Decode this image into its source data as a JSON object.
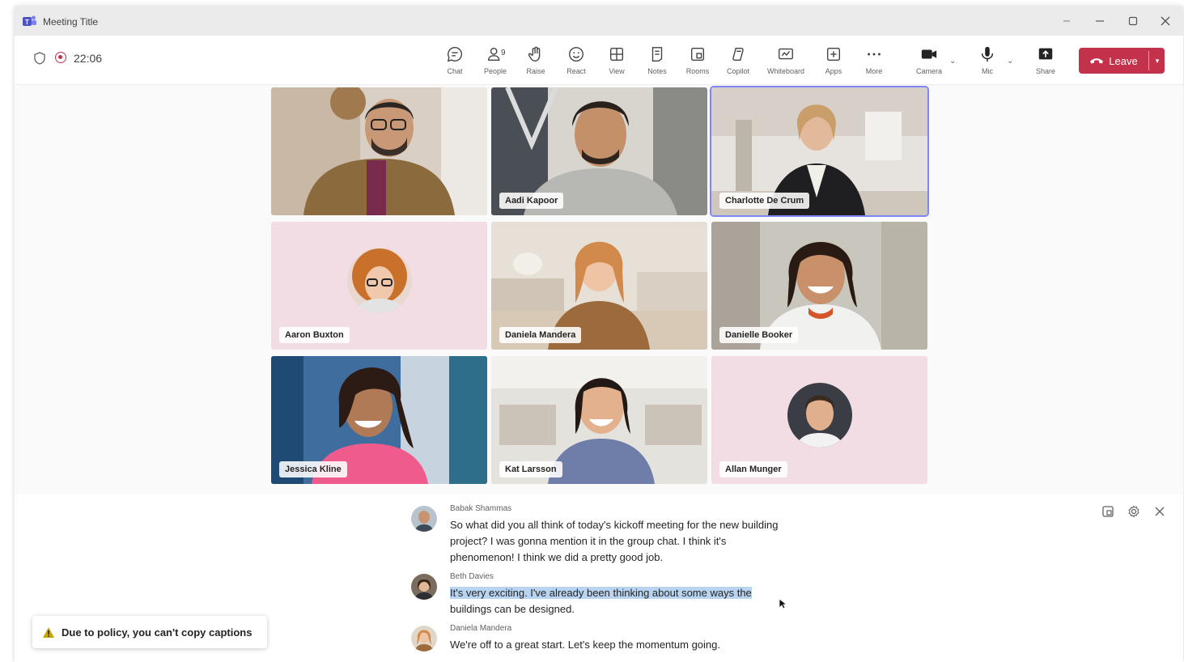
{
  "window": {
    "title": "Meeting Title"
  },
  "header": {
    "timer": "22:06",
    "people_count": "9"
  },
  "toolbar": {
    "items": [
      {
        "label": "Chat",
        "icon": "chat-icon"
      },
      {
        "label": "People",
        "icon": "people-icon"
      },
      {
        "label": "Raise",
        "icon": "raise-hand-icon"
      },
      {
        "label": "React",
        "icon": "react-icon"
      },
      {
        "label": "View",
        "icon": "view-icon"
      },
      {
        "label": "Notes",
        "icon": "notes-icon"
      },
      {
        "label": "Rooms",
        "icon": "rooms-icon"
      },
      {
        "label": "Copilot",
        "icon": "copilot-icon"
      },
      {
        "label": "Whiteboard",
        "icon": "whiteboard-icon"
      },
      {
        "label": "Apps",
        "icon": "apps-icon"
      },
      {
        "label": "More",
        "icon": "more-icon"
      },
      {
        "label": "Camera",
        "icon": "camera-icon"
      },
      {
        "label": "Mic",
        "icon": "mic-icon"
      },
      {
        "label": "Share",
        "icon": "share-icon"
      }
    ],
    "leave_label": "Leave"
  },
  "participants": [
    {
      "name": "",
      "tile": "video",
      "active": false
    },
    {
      "name": "Aadi Kapoor",
      "tile": "video",
      "active": false
    },
    {
      "name": "Charlotte De Crum",
      "tile": "video",
      "active": true
    },
    {
      "name": "Aaron Buxton",
      "tile": "avatar",
      "active": false
    },
    {
      "name": "Daniela Mandera",
      "tile": "video",
      "active": false
    },
    {
      "name": "Danielle Booker",
      "tile": "video",
      "active": false
    },
    {
      "name": "Jessica Kline",
      "tile": "video",
      "active": false
    },
    {
      "name": "Kat Larsson",
      "tile": "video",
      "active": false
    },
    {
      "name": "Allan Munger",
      "tile": "avatar",
      "active": false
    }
  ],
  "captions": [
    {
      "speaker": "Babak Shammas",
      "text": "So what did you all think of today's kickoff meeting for the new building project? I was gonna mention it in the group chat. I think it's phenomenon! I think we did a pretty good job."
    },
    {
      "speaker": "Beth Davies",
      "text_highlighted": "It's very exciting. I've already been thinking about some ways the",
      "text_rest": "buildings can be designed."
    },
    {
      "speaker": "Daniela Mandera",
      "text": "We're off to a great start. Let's keep the momentum going."
    }
  ],
  "toast": {
    "message": "Due to policy, you can't copy captions"
  },
  "colors": {
    "accent": "#7f85f5",
    "leave": "#c4314b",
    "highlight": "#b9d4f0"
  }
}
